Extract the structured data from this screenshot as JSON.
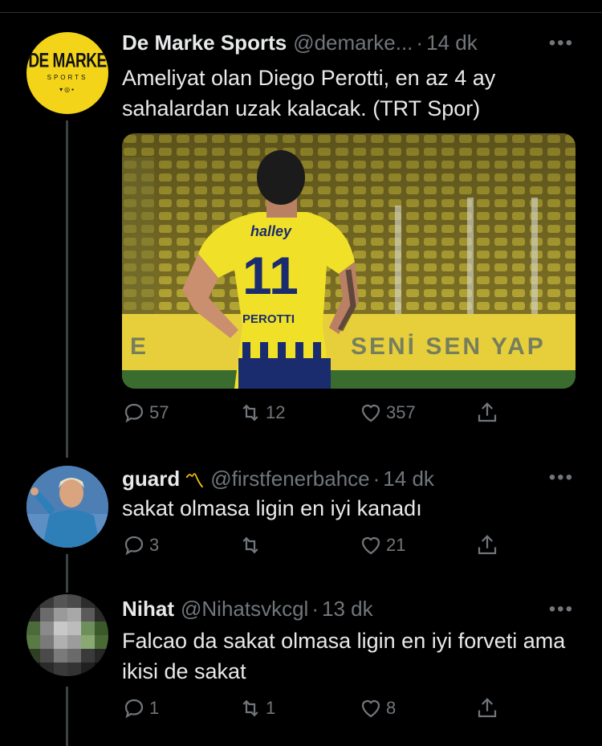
{
  "colors": {
    "background": "#000000",
    "text": "#e7e9ea",
    "muted": "#71767b",
    "brand_yellow": "#f4d419"
  },
  "tweets": [
    {
      "name": "De Marke Sports",
      "handle": "@demarke...",
      "sep": "·",
      "time": "14 dk",
      "avatar_logo": {
        "line1": "DE MARKE",
        "line2": "SPORTS"
      },
      "text": "Ameliyat olan Diego Perotti, en az 4 ay sahalardan uzak kalacak. (TRT Spor)",
      "media": {
        "jersey_number": "11",
        "jersey_name": "PEROTTI",
        "sponsor": "halley",
        "banner_text": "SENİ SEN YAP",
        "banner_left": "E"
      },
      "replies": "57",
      "retweets": "12",
      "likes": "357"
    },
    {
      "name": "guard",
      "name_emoji": "crown-icon",
      "handle": "@firstfenerbahce",
      "sep": "·",
      "time": "14 dk",
      "text": "sakat olmasa ligin en iyi kanadı",
      "replies": "3",
      "retweets": "",
      "likes": "21"
    },
    {
      "name": "Nihat",
      "handle": "@Nihatsvkcgl",
      "sep": "·",
      "time": "13 dk",
      "text": "Falcao da sakat olmasa ligin en iyi forveti ama ikisi de sakat",
      "replies": "1",
      "retweets": "1",
      "likes": "8"
    }
  ],
  "more_label": "•••"
}
